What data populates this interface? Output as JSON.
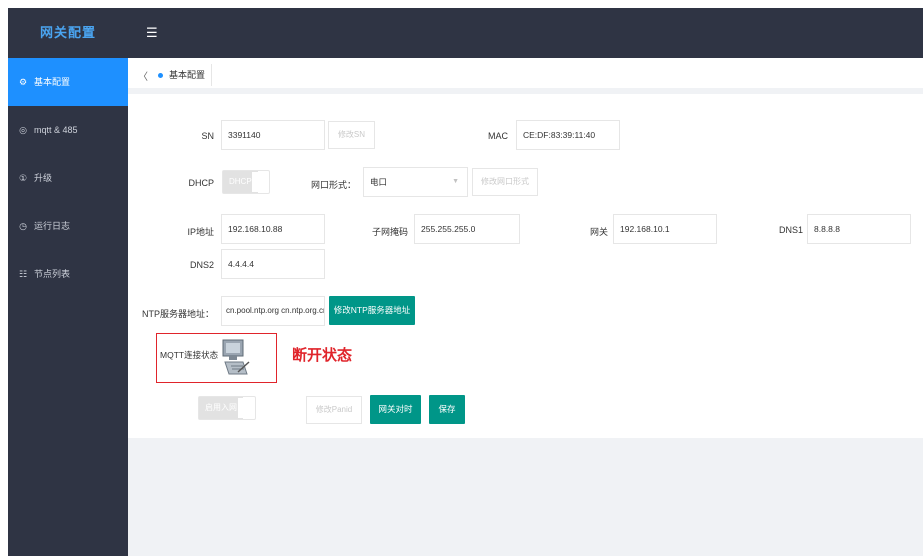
{
  "sidebar": {
    "logo": "网关配置",
    "items": [
      {
        "icon": "⚙",
        "label": "基本配置"
      },
      {
        "icon": "◎",
        "label": "mqtt & 485"
      },
      {
        "icon": "①",
        "label": "升级"
      },
      {
        "icon": "◷",
        "label": "运行日志"
      },
      {
        "icon": "☷",
        "label": "节点列表"
      }
    ]
  },
  "topbar": {
    "menu_icon": "☰"
  },
  "tabs": {
    "back": "〈",
    "active": "基本配置"
  },
  "form": {
    "sn_label": "SN",
    "sn_value": "3391140",
    "sn_button": "修改SN",
    "mac_label": "MAC",
    "mac_value": "CE:DF:83:39:11:40",
    "dhcp_label": "DHCP",
    "dhcp_switch": "DHCP",
    "port_label": "网口形式：",
    "port_value": "电口",
    "port_button": "修改网口形式",
    "ip_label": "IP地址",
    "ip_value": "192.168.10.88",
    "mask_label": "子网掩码",
    "mask_value": "255.255.255.0",
    "gw_label": "网关",
    "gw_value": "192.168.10.1",
    "dns1_label": "DNS1",
    "dns1_value": "8.8.8.8",
    "dns2_label": "DNS2",
    "dns2_value": "4.4.4.4",
    "ntp_label": "NTP服务器地址：",
    "ntp_value": "cn.pool.ntp.org cn.ntp.org.cn",
    "ntp_button": "修改NTP服务器地址",
    "mqtt_label": "MQTT连接状态",
    "mqtt_status": "断开状态",
    "join_switch": "启用入网",
    "panid_button": "修改Panid",
    "sync_button": "网关对时",
    "save_button": "保存"
  },
  "colors": {
    "sidebar_bg": "#2f3444",
    "active": "#1e90ff",
    "green": "#009688",
    "red": "#e0242b"
  }
}
